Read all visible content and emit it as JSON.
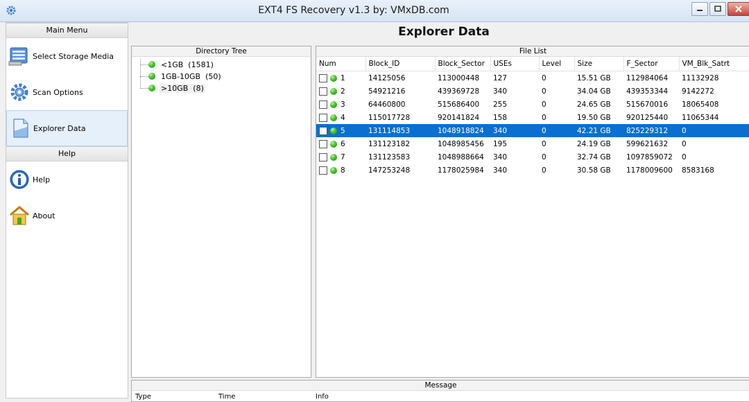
{
  "window": {
    "title": "EXT4 FS Recovery v1.3 by: VMxDB.com"
  },
  "left_menu": {
    "main_header": "Main Menu",
    "main_items": [
      {
        "label": "Select Storage Media",
        "icon": "storage-media-icon"
      },
      {
        "label": "Scan Options",
        "icon": "gear-icon"
      },
      {
        "label": "Explorer Data",
        "icon": "document-icon",
        "active": true
      }
    ],
    "help_header": "Help",
    "help_items": [
      {
        "label": "Help",
        "icon": "info-icon"
      },
      {
        "label": "About",
        "icon": "home-icon"
      }
    ]
  },
  "main": {
    "title": "Explorer Data",
    "tree": {
      "header": "Directory Tree",
      "nodes": [
        {
          "label": "<1GB",
          "count": "(1581)"
        },
        {
          "label": "1GB-10GB",
          "count": "(50)"
        },
        {
          "label": ">10GB",
          "count": "(8)",
          "selected": true
        }
      ]
    },
    "file_list": {
      "header": "File List",
      "columns": [
        "Num",
        "Block_ID",
        "Block_Sector",
        "USEs",
        "Level",
        "Size",
        "F_Sector",
        "VM_Blk_Satrt"
      ],
      "rows": [
        [
          "1",
          "14125056",
          "113000448",
          "127",
          "0",
          "15.51 GB",
          "112984064",
          "11132928"
        ],
        [
          "2",
          "54921216",
          "439369728",
          "340",
          "0",
          "34.04 GB",
          "439353344",
          "9142272"
        ],
        [
          "3",
          "64460800",
          "515686400",
          "255",
          "0",
          "24.65 GB",
          "515670016",
          "18065408"
        ],
        [
          "4",
          "115017728",
          "920141824",
          "158",
          "0",
          "19.50 GB",
          "920125440",
          "11065344"
        ],
        [
          "5",
          "131114853",
          "1048918824",
          "340",
          "0",
          "42.21 GB",
          "825229312",
          "0"
        ],
        [
          "6",
          "131123182",
          "1048985456",
          "195",
          "0",
          "24.19 GB",
          "599621632",
          "0"
        ],
        [
          "7",
          "131123583",
          "1048988664",
          "340",
          "0",
          "32.74 GB",
          "1097859072",
          "0"
        ],
        [
          "8",
          "147253248",
          "1178025984",
          "340",
          "0",
          "30.58 GB",
          "1178009600",
          "8583168"
        ]
      ],
      "selected_row_index": 4
    },
    "message": {
      "header": "Message",
      "columns": [
        "Type",
        "Time",
        "Info"
      ]
    }
  },
  "colors": {
    "selection": "#0a6fd1",
    "accent": "#45c12a"
  }
}
